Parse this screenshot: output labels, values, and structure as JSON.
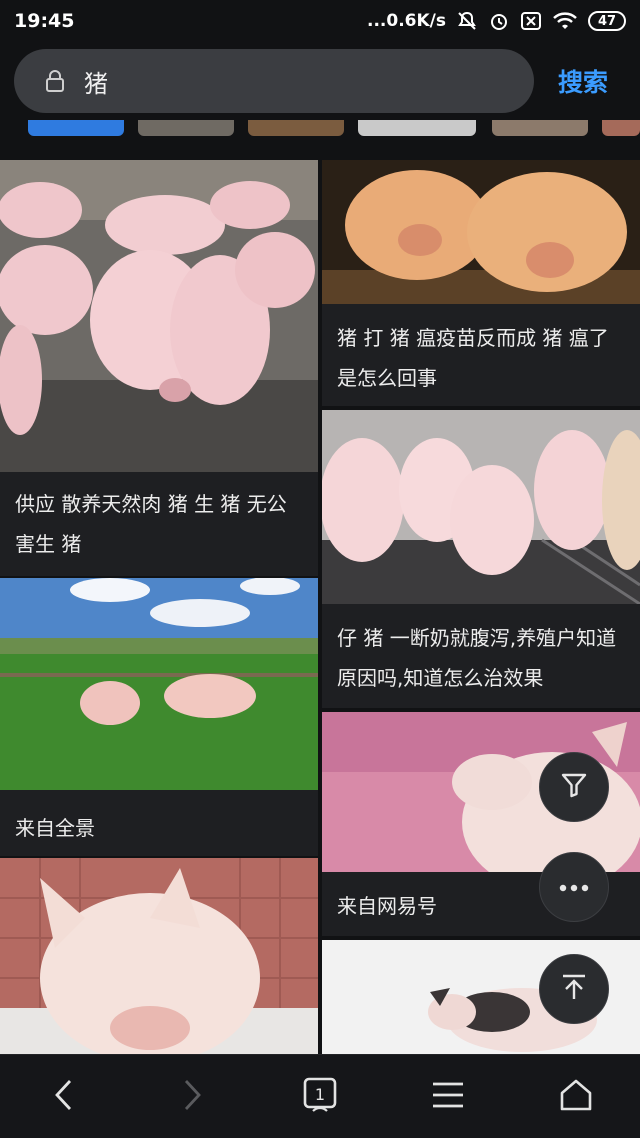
{
  "status_bar": {
    "time": "19:45",
    "speed": "...0.6K/s",
    "battery": "47"
  },
  "search": {
    "query": "猪",
    "button_label": "搜索"
  },
  "results": [
    {
      "caption": "供应 散养天然肉 猪 生 猪 无公害生 猪",
      "image": "pigs-in-pen"
    },
    {
      "caption": "猪 打 猪 瘟疫苗反而成 猪 瘟了是怎么回事",
      "image": "two-piglets-at-fence"
    },
    {
      "caption": "仔 猪 一断奶就腹泻,养殖户知道原因吗,知道怎么治效果",
      "image": "piglets-group"
    },
    {
      "caption": "来自全景",
      "image": "pigs-on-grass"
    },
    {
      "caption": "来自网易号",
      "image": "pig-pink-background"
    },
    {
      "caption": "",
      "image": "pig-in-tub"
    },
    {
      "caption": "",
      "image": "spotted-pig-white"
    }
  ],
  "icons": {
    "lock": "lock-icon",
    "filter": "filter-icon",
    "more": "more-icon",
    "top": "back-to-top-icon",
    "back": "back-icon",
    "forward": "forward-icon",
    "tabs": "tabs-icon",
    "menu": "menu-icon",
    "home": "home-icon"
  },
  "colors": {
    "accent": "#3b9cff",
    "background": "#111214"
  }
}
